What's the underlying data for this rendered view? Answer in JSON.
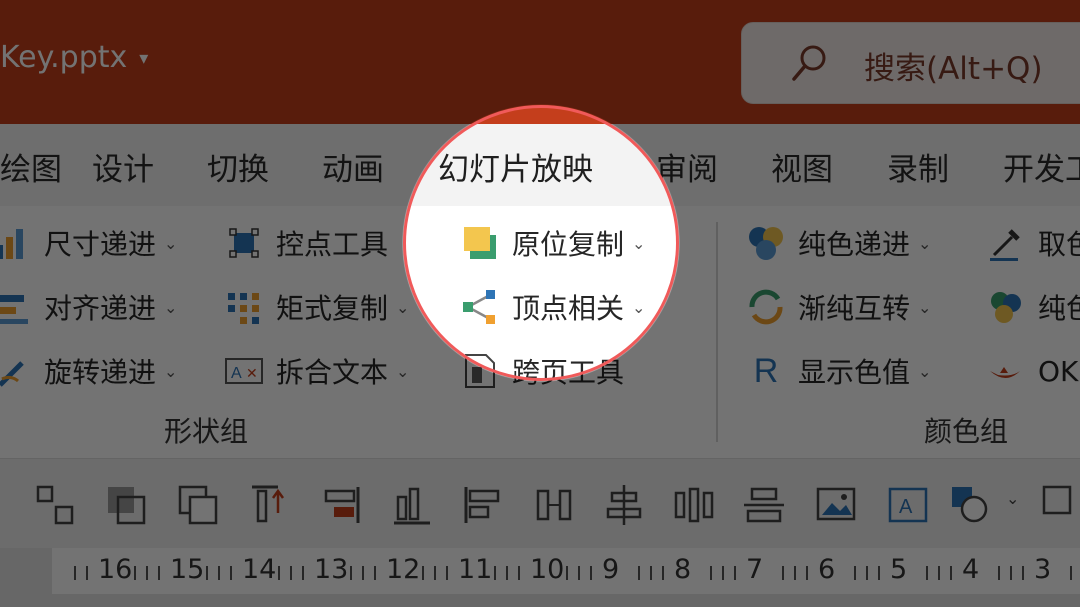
{
  "window": {
    "filename": "Key.pptx",
    "caret": "▾"
  },
  "search": {
    "label": "搜索(Alt+Q)"
  },
  "tabs": [
    "绘图",
    "设计",
    "切换",
    "动画",
    "幻灯片放映",
    "审阅",
    "视图",
    "录制",
    "开发工"
  ],
  "shape_group": {
    "label": "形状组",
    "commands": [
      {
        "label": "尺寸递进",
        "icon": "size-progression-icon",
        "dropdown": "⌄"
      },
      {
        "label": "对齐递进",
        "icon": "align-progression-icon",
        "dropdown": "⌄"
      },
      {
        "label": "旋转递进",
        "icon": "rotate-progression-icon",
        "dropdown": "⌄"
      },
      {
        "label": "控点工具",
        "icon": "handle-tool-icon"
      },
      {
        "label": "矩式复制",
        "icon": "matrix-copy-icon",
        "dropdown": "⌄"
      },
      {
        "label": "拆合文本",
        "icon": "split-text-icon",
        "dropdown": "⌄"
      },
      {
        "label": "原位复制",
        "icon": "in-place-copy-icon",
        "dropdown": "⌄"
      },
      {
        "label": "顶点相关",
        "icon": "vertex-icon",
        "dropdown": "⌄"
      },
      {
        "label": "跨页工具",
        "icon": "cross-page-tool-icon"
      }
    ]
  },
  "color_group": {
    "label": "颜色组",
    "commands": [
      {
        "label": "纯色递进",
        "icon": "solid-color-progression-icon",
        "dropdown": "⌄"
      },
      {
        "label": "渐纯互转",
        "icon": "gradient-solid-convert-icon",
        "dropdown": "⌄"
      },
      {
        "label": "显示色值",
        "icon": "show-color-value-icon",
        "icon_text": "R",
        "dropdown": "⌄"
      },
      {
        "label": "取色",
        "icon": "eyedropper-icon"
      },
      {
        "label": "纯色",
        "icon": "solid-color-icon"
      },
      {
        "label": "OK",
        "icon": "okey-lamp-icon"
      }
    ]
  },
  "quick_access_icons": [
    "group-icon",
    "ungroup-icon",
    "bring-forward-icon",
    "send-backward-icon",
    "align-top-icon",
    "align-right-icon",
    "align-bottom-icon",
    "align-left-icon",
    "distribute-horizontal-icon",
    "align-center-horizontal-icon",
    "align-middle-icon",
    "align-center-vertical-icon",
    "picture-icon",
    "text-box-icon",
    "shapes-icon"
  ],
  "ruler": {
    "labels": [
      "16",
      "15",
      "14",
      "13",
      "12",
      "11",
      "10",
      "9",
      "8",
      "7",
      "6",
      "5",
      "4",
      "3"
    ]
  },
  "colors": {
    "titlebar": "#c43e1c",
    "highlight_ring": "#f05a5a"
  }
}
